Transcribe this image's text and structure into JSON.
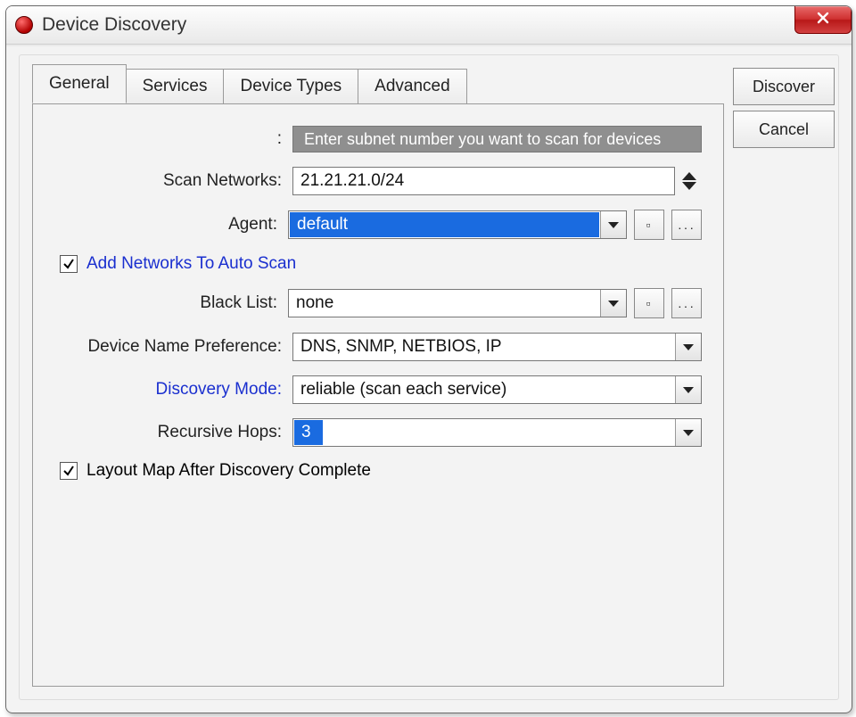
{
  "window": {
    "title": "Device Discovery"
  },
  "tabs": {
    "items": [
      "General",
      "Services",
      "Device Types",
      "Advanced"
    ],
    "active": 0
  },
  "side": {
    "discover": "Discover",
    "cancel": "Cancel"
  },
  "form": {
    "hint_label": ":",
    "hint_text": "Enter subnet number you want to scan for devices",
    "scan_networks_label": "Scan Networks:",
    "scan_networks_value": "21.21.21.0/24",
    "agent_label": "Agent:",
    "agent_value": "default",
    "auto_scan_checked": true,
    "auto_scan_label": "Add Networks To Auto Scan",
    "blacklist_label": "Black List:",
    "blacklist_value": "none",
    "dnp_label": "Device Name Preference:",
    "dnp_value": "DNS, SNMP, NETBIOS, IP",
    "disc_mode_label": "Discovery Mode:",
    "disc_mode_value": "reliable (scan each service)",
    "hops_label": "Recursive Hops:",
    "hops_value": "3",
    "layout_checked": true,
    "layout_label": "Layout Map After Discovery Complete",
    "tiny_dot": "▫",
    "tiny_dots": "․․․"
  }
}
